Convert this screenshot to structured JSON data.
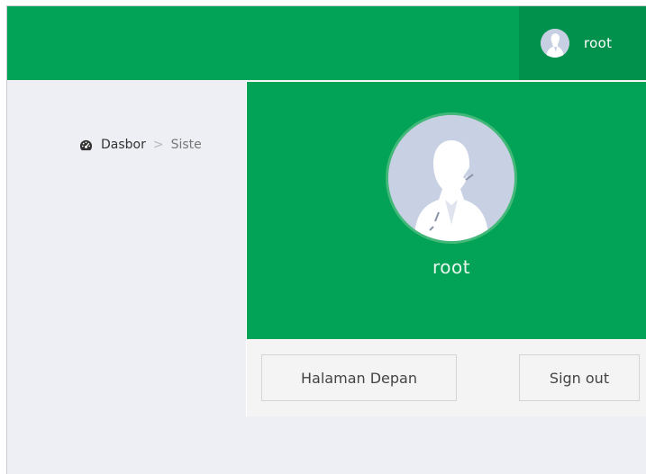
{
  "header": {
    "username": "root"
  },
  "breadcrumb": {
    "icon": "dashboard-icon",
    "home_label": "Dasbor",
    "separator": ">",
    "current_label": "Siste"
  },
  "user_dropdown": {
    "name": "root",
    "home_button_label": "Halaman Depan",
    "signout_button_label": "Sign out"
  },
  "colors": {
    "brand_green": "#03a357",
    "brand_green_dark": "#02914c",
    "page_background": "#edeff4",
    "avatar_background": "#c8d0e3"
  }
}
